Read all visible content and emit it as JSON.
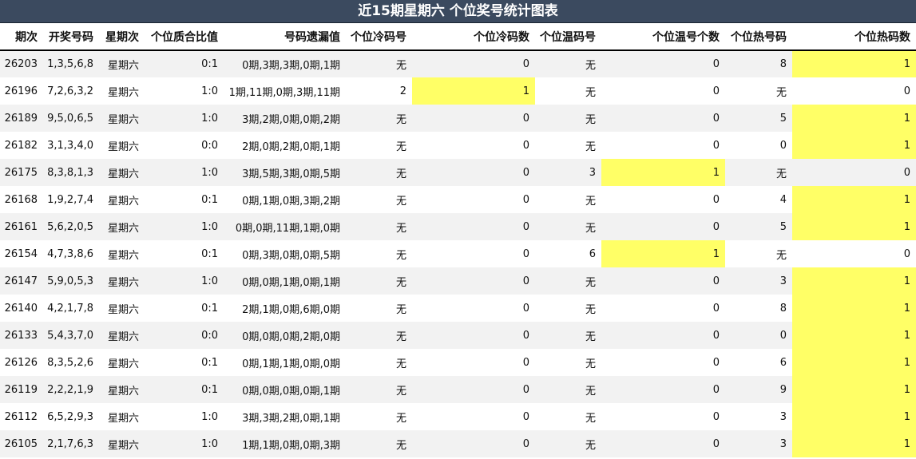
{
  "title": "近15期星期六 个位奖号统计图表",
  "headers": [
    "期次",
    "开奖号码",
    "星期次",
    "个位质合比值",
    "号码遗漏值",
    "个位冷码号",
    "个位冷码数",
    "个位温码号",
    "个位温号个数",
    "个位热号码",
    "个位热码数"
  ],
  "highlight_color": "#ffff66",
  "rows": [
    {
      "period": "26203",
      "numbers": "1,3,5,6,8",
      "weekday": "星期六",
      "ratio": "0:1",
      "missing": "0期,3期,3期,0期,1期",
      "cold_num": "无",
      "cold_count": "0",
      "warm_num": "无",
      "warm_count": "0",
      "hot_num": "8",
      "hot_count": "1",
      "highlight": "hot_count"
    },
    {
      "period": "26196",
      "numbers": "7,2,6,3,2",
      "weekday": "星期六",
      "ratio": "1:0",
      "missing": "1期,11期,0期,3期,11期",
      "cold_num": "2",
      "cold_count": "1",
      "warm_num": "无",
      "warm_count": "0",
      "hot_num": "无",
      "hot_count": "0",
      "highlight": "cold_count"
    },
    {
      "period": "26189",
      "numbers": "9,5,0,6,5",
      "weekday": "星期六",
      "ratio": "1:0",
      "missing": "3期,2期,0期,0期,2期",
      "cold_num": "无",
      "cold_count": "0",
      "warm_num": "无",
      "warm_count": "0",
      "hot_num": "5",
      "hot_count": "1",
      "highlight": "hot_count"
    },
    {
      "period": "26182",
      "numbers": "3,1,3,4,0",
      "weekday": "星期六",
      "ratio": "0:0",
      "missing": "2期,0期,2期,0期,1期",
      "cold_num": "无",
      "cold_count": "0",
      "warm_num": "无",
      "warm_count": "0",
      "hot_num": "0",
      "hot_count": "1",
      "highlight": "hot_count"
    },
    {
      "period": "26175",
      "numbers": "8,3,8,1,3",
      "weekday": "星期六",
      "ratio": "1:0",
      "missing": "3期,5期,3期,0期,5期",
      "cold_num": "无",
      "cold_count": "0",
      "warm_num": "3",
      "warm_count": "1",
      "hot_num": "无",
      "hot_count": "0",
      "highlight": "warm_count"
    },
    {
      "period": "26168",
      "numbers": "1,9,2,7,4",
      "weekday": "星期六",
      "ratio": "0:1",
      "missing": "0期,1期,0期,3期,2期",
      "cold_num": "无",
      "cold_count": "0",
      "warm_num": "无",
      "warm_count": "0",
      "hot_num": "4",
      "hot_count": "1",
      "highlight": "hot_count"
    },
    {
      "period": "26161",
      "numbers": "5,6,2,0,5",
      "weekday": "星期六",
      "ratio": "1:0",
      "missing": "0期,0期,11期,1期,0期",
      "cold_num": "无",
      "cold_count": "0",
      "warm_num": "无",
      "warm_count": "0",
      "hot_num": "5",
      "hot_count": "1",
      "highlight": "hot_count"
    },
    {
      "period": "26154",
      "numbers": "4,7,3,8,6",
      "weekday": "星期六",
      "ratio": "0:1",
      "missing": "0期,3期,0期,0期,5期",
      "cold_num": "无",
      "cold_count": "0",
      "warm_num": "6",
      "warm_count": "1",
      "hot_num": "无",
      "hot_count": "0",
      "highlight": "warm_count"
    },
    {
      "period": "26147",
      "numbers": "5,9,0,5,3",
      "weekday": "星期六",
      "ratio": "1:0",
      "missing": "0期,0期,1期,0期,1期",
      "cold_num": "无",
      "cold_count": "0",
      "warm_num": "无",
      "warm_count": "0",
      "hot_num": "3",
      "hot_count": "1",
      "highlight": "hot_count"
    },
    {
      "period": "26140",
      "numbers": "4,2,1,7,8",
      "weekday": "星期六",
      "ratio": "0:1",
      "missing": "2期,1期,0期,6期,0期",
      "cold_num": "无",
      "cold_count": "0",
      "warm_num": "无",
      "warm_count": "0",
      "hot_num": "8",
      "hot_count": "1",
      "highlight": "hot_count"
    },
    {
      "period": "26133",
      "numbers": "5,4,3,7,0",
      "weekday": "星期六",
      "ratio": "0:0",
      "missing": "0期,0期,0期,2期,0期",
      "cold_num": "无",
      "cold_count": "0",
      "warm_num": "无",
      "warm_count": "0",
      "hot_num": "0",
      "hot_count": "1",
      "highlight": "hot_count"
    },
    {
      "period": "26126",
      "numbers": "8,3,5,2,6",
      "weekday": "星期六",
      "ratio": "0:1",
      "missing": "0期,1期,1期,0期,0期",
      "cold_num": "无",
      "cold_count": "0",
      "warm_num": "无",
      "warm_count": "0",
      "hot_num": "6",
      "hot_count": "1",
      "highlight": "hot_count"
    },
    {
      "period": "26119",
      "numbers": "2,2,2,1,9",
      "weekday": "星期六",
      "ratio": "0:1",
      "missing": "0期,0期,0期,0期,1期",
      "cold_num": "无",
      "cold_count": "0",
      "warm_num": "无",
      "warm_count": "0",
      "hot_num": "9",
      "hot_count": "1",
      "highlight": "hot_count"
    },
    {
      "period": "26112",
      "numbers": "6,5,2,9,3",
      "weekday": "星期六",
      "ratio": "1:0",
      "missing": "3期,3期,2期,0期,1期",
      "cold_num": "无",
      "cold_count": "0",
      "warm_num": "无",
      "warm_count": "0",
      "hot_num": "3",
      "hot_count": "1",
      "highlight": "hot_count"
    },
    {
      "period": "26105",
      "numbers": "2,1,7,6,3",
      "weekday": "星期六",
      "ratio": "1:0",
      "missing": "1期,1期,0期,0期,3期",
      "cold_num": "无",
      "cold_count": "0",
      "warm_num": "无",
      "warm_count": "0",
      "hot_num": "3",
      "hot_count": "1",
      "highlight": "hot_count"
    }
  ]
}
